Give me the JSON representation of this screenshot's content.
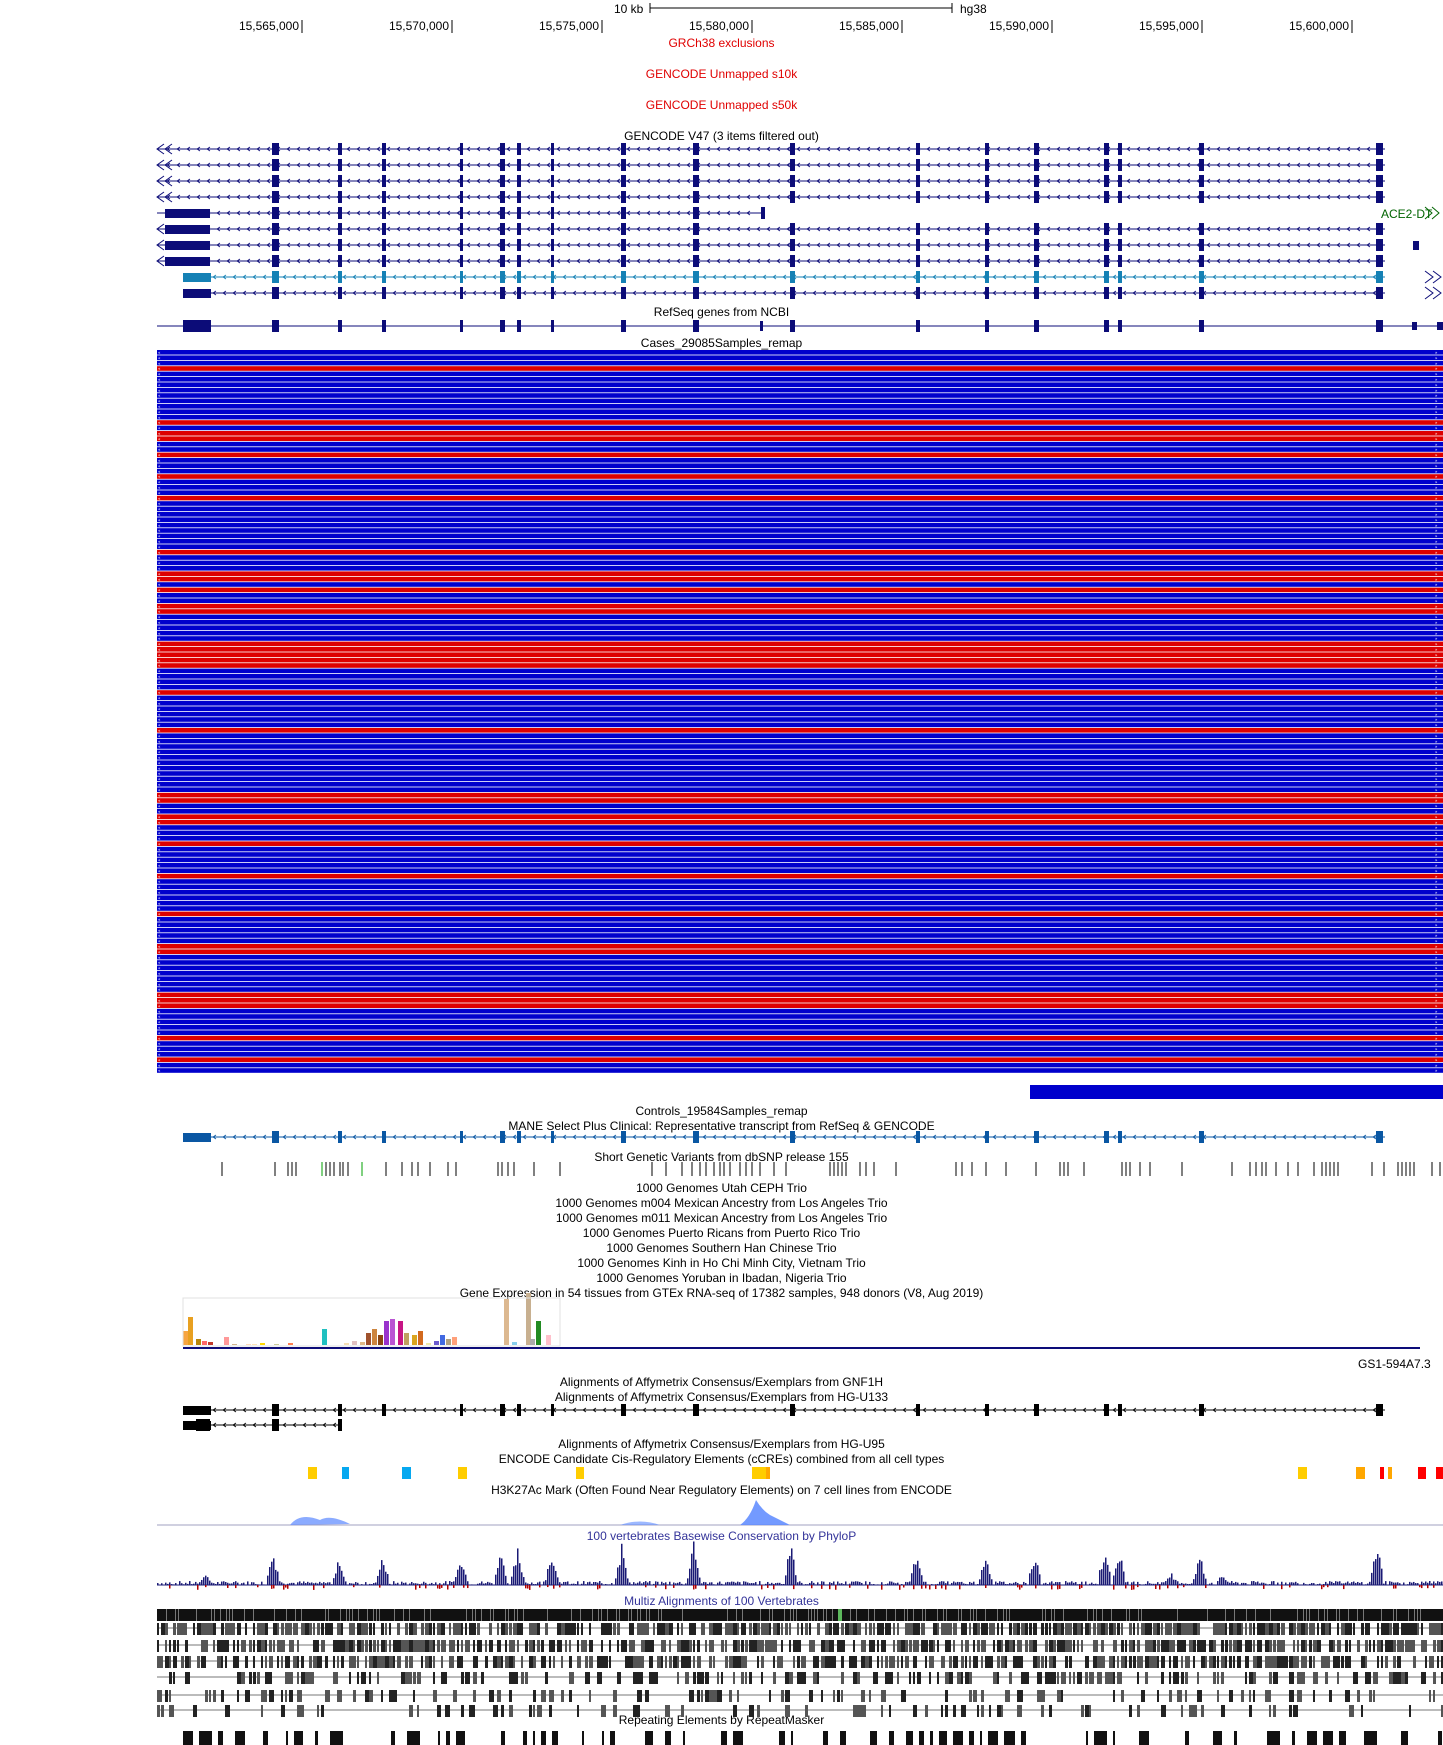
{
  "ruler": {
    "scale_label": "10 kb",
    "assembly": "hg38",
    "ticks": [
      "15,565,000",
      "15,570,000",
      "15,575,000",
      "15,580,000",
      "15,585,000",
      "15,590,000",
      "15,595,000",
      "15,600,000"
    ]
  },
  "tracks": {
    "grch38_exclusions": "GRCh38 exclusions",
    "gencode_unmapped_s10k": "GENCODE Unmapped s10k",
    "gencode_unmapped_s50k": "GENCODE Unmapped s50k",
    "gencode_v47": "GENCODE V47 (3 items filtered out)",
    "refseq": "RefSeq genes from NCBI",
    "cases": "Cases_29085Samples_remap",
    "controls": "Controls_19584Samples_remap",
    "mane": "MANE Select Plus Clinical: Representative transcript from RefSeq & GENCODE",
    "dbsnp": "Short Genetic Variants from dbSNP release 155",
    "trio_ceph": "1000 Genomes Utah CEPH Trio",
    "trio_m004": "1000 Genomes m004 Mexican Ancestry from Los Angeles Trio",
    "trio_m011": "1000 Genomes m011 Mexican Ancestry from Los Angeles Trio",
    "trio_pr": "1000 Genomes Puerto Ricans from Puerto Rico Trio",
    "trio_han": "1000 Genomes Southern Han Chinese Trio",
    "trio_kinh": "1000 Genomes Kinh in Ho Chi Minh City, Vietnam Trio",
    "trio_yoruba": "1000 Genomes Yoruban in Ibadan, Nigeria Trio",
    "gtex": "Gene Expression in 54 tissues from GTEx RNA-seq of 17382 samples, 948 donors (V8, Aug 2019)",
    "affy_gnf1h": "Alignments of Affymetrix Consensus/Exemplars from GNF1H",
    "affy_u133": "Alignments of Affymetrix Consensus/Exemplars from HG-U133",
    "affy_u95": "Alignments of Affymetrix Consensus/Exemplars from HG-U95",
    "encode_ccre": "ENCODE Candidate Cis-Regulatory Elements (cCREs) combined from all cell types",
    "h3k27ac": "H3K27Ac Mark (Often Found Near Regulatory Elements) on 7 cell lines from ENCODE",
    "phylop": "100 vertebrates Basewise Conservation by PhyloP",
    "multiz": "Multiz Alignments of 100 Vertebrates",
    "repeatmasker": "Repeating Elements by RepeatMasker"
  },
  "labels": {
    "ace2_gene": "ACE2-DT",
    "gs1_gene": "GS1-594A7.3"
  },
  "case_rows": "BBBRBBBBBBBBBRBRRBBRBBBRBBBRBBBBBBBBBRBBBRRBRBBRRBBBBBRRRRRBBBBRBBBBBBRBBBBBBBBBBBRRBBRRBBBRBBBBBRBBBBBBRBBBBBRRBBBBBBBRRRBBBBBRBBBRBB",
  "colors": {
    "case_red": "#dd0000",
    "case_blue": "#0000cc",
    "gene_navy": "#0c0c78",
    "mane_blue": "#0a57a3",
    "ccre_yellow": "#ffcd00",
    "ccre_blue": "#06a8f0",
    "ccre_orange": "#ffa700",
    "ccre_red": "#ff0000",
    "phylop_navy": "#1a1a75",
    "phylop_neg": "#b00000",
    "h3k27ac_blue": "#5a88ff"
  }
}
